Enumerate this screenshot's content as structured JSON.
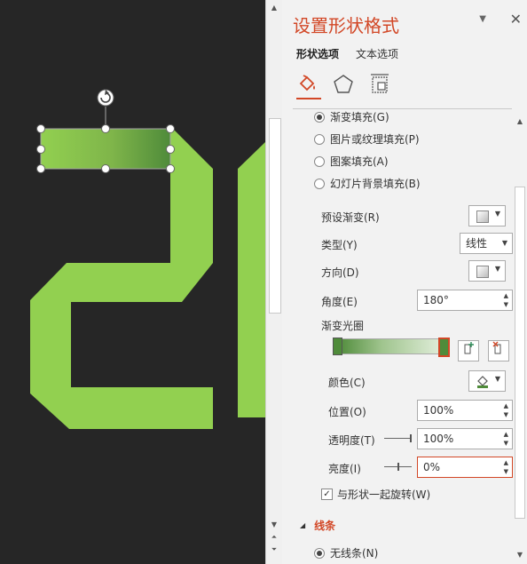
{
  "pane": {
    "title": "设置形状格式",
    "tabs": [
      "形状选项",
      "文本选项"
    ],
    "icons": [
      "fill-line-icon",
      "effects-pentagon-icon",
      "size-properties-icon"
    ]
  },
  "fill_options": [
    {
      "label": "渐变填充(G)",
      "checked": true
    },
    {
      "label": "图片或纹理填充(P)",
      "checked": false
    },
    {
      "label": "图案填充(A)",
      "checked": false
    },
    {
      "label": "幻灯片背景填充(B)",
      "checked": false
    }
  ],
  "gradient": {
    "preset_label": "预设渐变(R)",
    "type_label": "类型(Y)",
    "type_value": "线性",
    "direction_label": "方向(D)",
    "angle_label": "角度(E)",
    "angle_value": "180°",
    "stops_label": "渐变光圈",
    "color_label": "颜色(C)",
    "position_label": "位置(O)",
    "position_value": "100%",
    "transparency_label": "透明度(T)",
    "transparency_value": "100%",
    "brightness_label": "亮度(I)",
    "brightness_value": "0%",
    "rotate_label": "与形状一起旋转(W)",
    "rotate_checked": true
  },
  "line_section": {
    "header": "线条",
    "no_line_label": "无线条(N)"
  },
  "colors": {
    "accent": "#d24726",
    "shape_green": "#92d050",
    "gradient_dark": "#4f8b3a"
  }
}
